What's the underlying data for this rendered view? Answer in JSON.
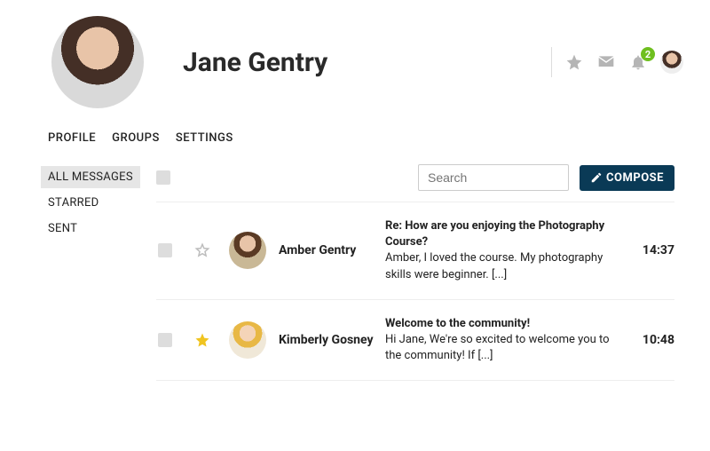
{
  "profile": {
    "name": "Jane Gentry"
  },
  "notifications": {
    "count": "2"
  },
  "tabs": {
    "profile": "PROFILE",
    "groups": "GROUPS",
    "settings": "SETTINGS"
  },
  "folders": {
    "all": "ALL MESSAGES",
    "starred": "STARRED",
    "sent": "SENT"
  },
  "search": {
    "placeholder": "Search"
  },
  "toolbar": {
    "compose": "COMPOSE"
  },
  "messages": [
    {
      "sender": "Amber Gentry",
      "subject": "Re: How are you enjoying the Photography Course?",
      "preview": "Amber, I loved the course. My photography skills were beginner. [...]",
      "time": "14:37",
      "starred": false
    },
    {
      "sender": "Kimberly Gosney",
      "subject": "Welcome to the community!",
      "preview": "Hi Jane, We're so excited to welcome you to the community! If [...]",
      "time": "10:48",
      "starred": true
    }
  ],
  "colors": {
    "accent": "#0a3a56",
    "badge": "#6fbf1f",
    "star": "#f0c420"
  }
}
